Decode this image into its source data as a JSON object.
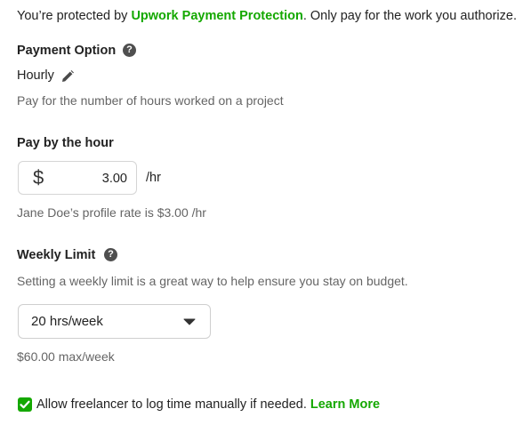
{
  "protection": {
    "prefix": "You’re protected by ",
    "link": "Upwork Payment Protection",
    "suffix": ". Only pay for the work you authorize."
  },
  "payment_option": {
    "heading": "Payment Option",
    "help_icon": "question-circle-icon",
    "value": "Hourly",
    "edit_icon": "pencil-icon",
    "description": "Pay for the number of hours worked on a project"
  },
  "pay_by_hour": {
    "heading": "Pay by the hour",
    "currency_symbol": "$",
    "rate_value": "3.00",
    "unit": "/hr",
    "profile_rate_note": "Jane Doe’s profile rate is $3.00 /hr"
  },
  "weekly_limit": {
    "heading": "Weekly Limit",
    "help_icon": "question-circle-icon",
    "description": "Setting a weekly limit is a great way to help ensure you stay on budget.",
    "selected": "20 hrs/week",
    "caret_icon": "caret-down-icon",
    "max_note": "$60.00 max/week"
  },
  "manual_time": {
    "checked": true,
    "label": "Allow freelancer to log time manually if needed. ",
    "link": "Learn More"
  },
  "colors": {
    "accent": "#14a800",
    "text": "#222222",
    "muted": "#656565"
  }
}
